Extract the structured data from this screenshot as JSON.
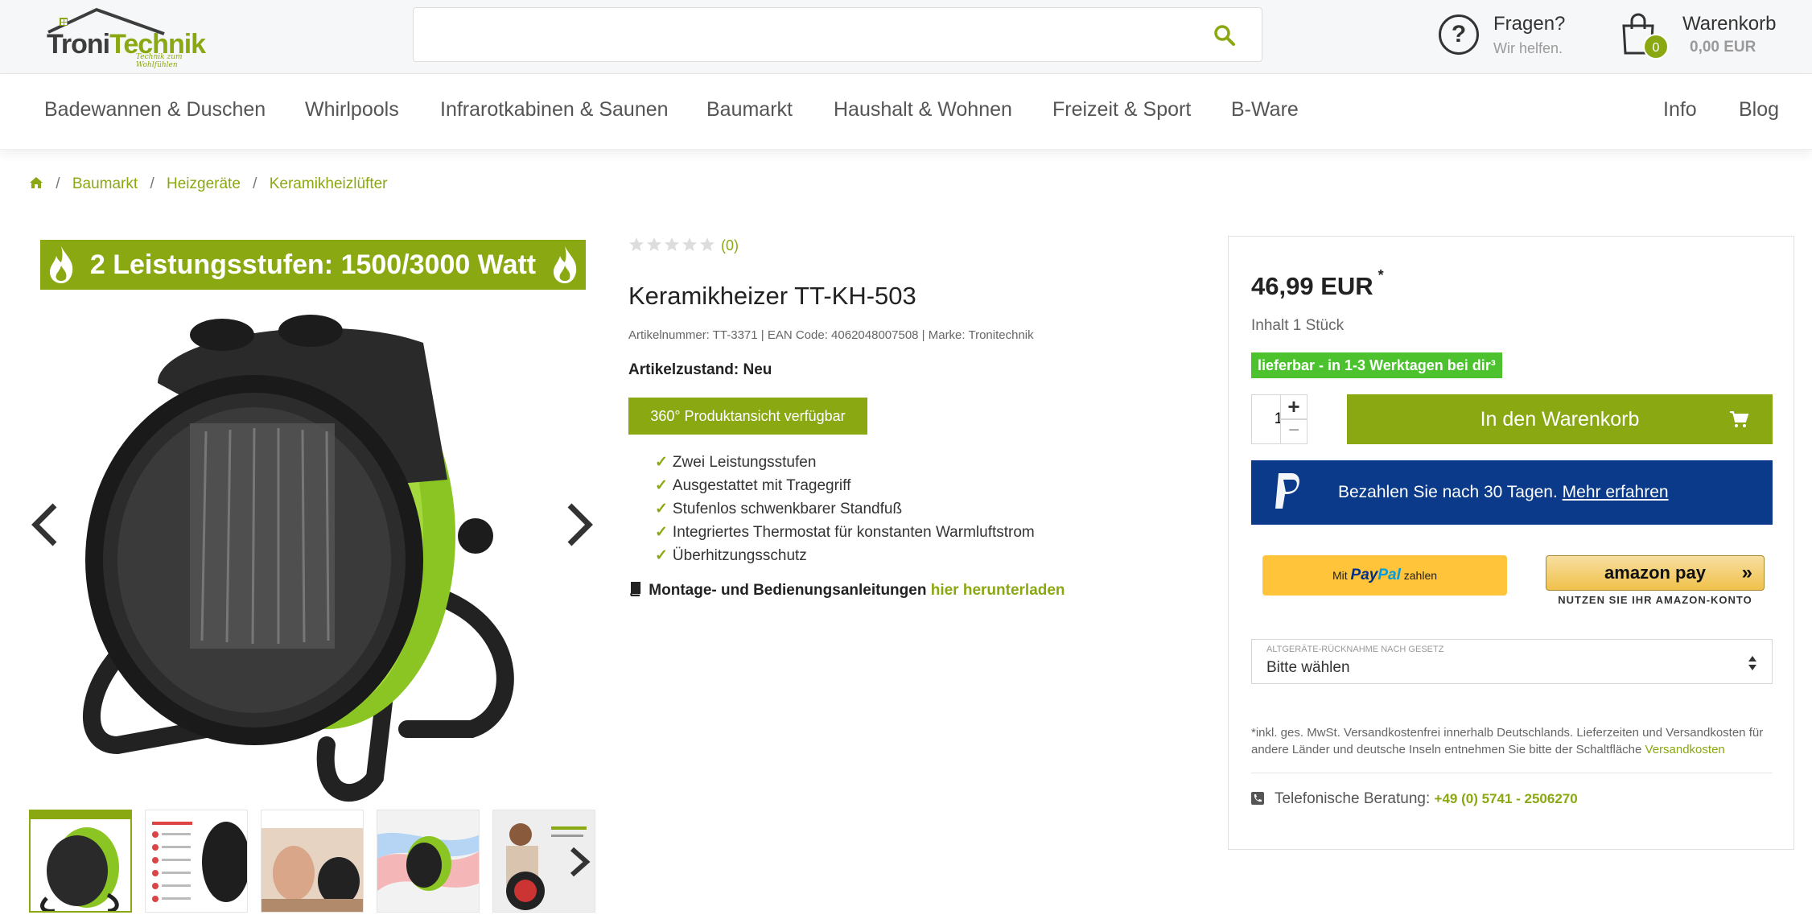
{
  "header": {
    "logo": {
      "word_a": "Troni",
      "word_b": "Technik",
      "tagline": "Technik zum Wohlfühlen"
    },
    "search": {
      "placeholder": "",
      "value": ""
    },
    "help": {
      "title": "Fragen?",
      "subtitle": "Wir helfen."
    },
    "cart": {
      "title": "Warenkorb",
      "count": "0",
      "total": "0,00 EUR"
    }
  },
  "nav": {
    "items": [
      "Badewannen & Duschen",
      "Whirlpools",
      "Infrarotkabinen & Saunen",
      "Baumarkt",
      "Haushalt & Wohnen",
      "Freizeit & Sport",
      "B-Ware"
    ],
    "right": [
      "Info",
      "Blog"
    ]
  },
  "breadcrumb": [
    "Baumarkt",
    "Heizgeräte",
    "Keramikheizlüfter"
  ],
  "gallery": {
    "banner": "2 Leistungsstufen: 1500/3000 Watt",
    "thumbnail_count": 5
  },
  "product": {
    "rating_count": "(0)",
    "title": "Keramikheizer TT-KH-503",
    "meta": "Artikelnummer: TT-3371 | EAN Code: 4062048007508 | Marke: Tronitechnik",
    "condition": "Artikelzustand: Neu",
    "view360": "360° Produktansicht verfügbar",
    "features": [
      "Zwei Leistungsstufen",
      "Ausgestattet mit Tragegriff",
      "Stufenlos schwenkbarer Standfuß",
      "Integriertes Thermostat für konstanten Warmluftstrom",
      "Überhitzungsschutz"
    ],
    "manual_text": "Montage- und Bedienungsanleitungen",
    "manual_link": "hier herunterladen"
  },
  "buybox": {
    "price": "46,99 EUR",
    "price_mark": "*",
    "content": "Inhalt 1 Stück",
    "stock": "lieferbar - in 1-3 Werktagen bei dir³",
    "quantity": "1",
    "add_to_cart": "In den Warenkorb",
    "paypal_later_text": "Bezahlen Sie nach 30 Tagen.",
    "paypal_later_link": "Mehr erfahren",
    "paypal_btn_pre": "Mit",
    "paypal_btn_pay": "Pay",
    "paypal_btn_pal": "Pal",
    "paypal_btn_post": "zahlen",
    "amazon_word": "amazon pay",
    "amazon_sub": "NUTZEN SIE IHR AMAZON-KONTO",
    "select_label": "ALTGERÄTE-RÜCKNAHME NACH GESETZ",
    "select_value": "Bitte wählen",
    "note": "*inkl. ges. MwSt. Versandkostenfrei innerhalb Deutschlands. Lieferzeiten und Versandkosten für andere Länder und deutsche Inseln entnehmen Sie bitte der Schaltfläche",
    "note_link": "Versandkosten",
    "phone_label": "Telefonische Beratung:",
    "phone_number": "+49 (0) 5741 - 2506270"
  },
  "colors": {
    "brand_green": "#8aa811",
    "stock_green": "#4cc32e",
    "paypal_blue": "#0b3a8a",
    "paypal_yellow": "#ffc439"
  }
}
